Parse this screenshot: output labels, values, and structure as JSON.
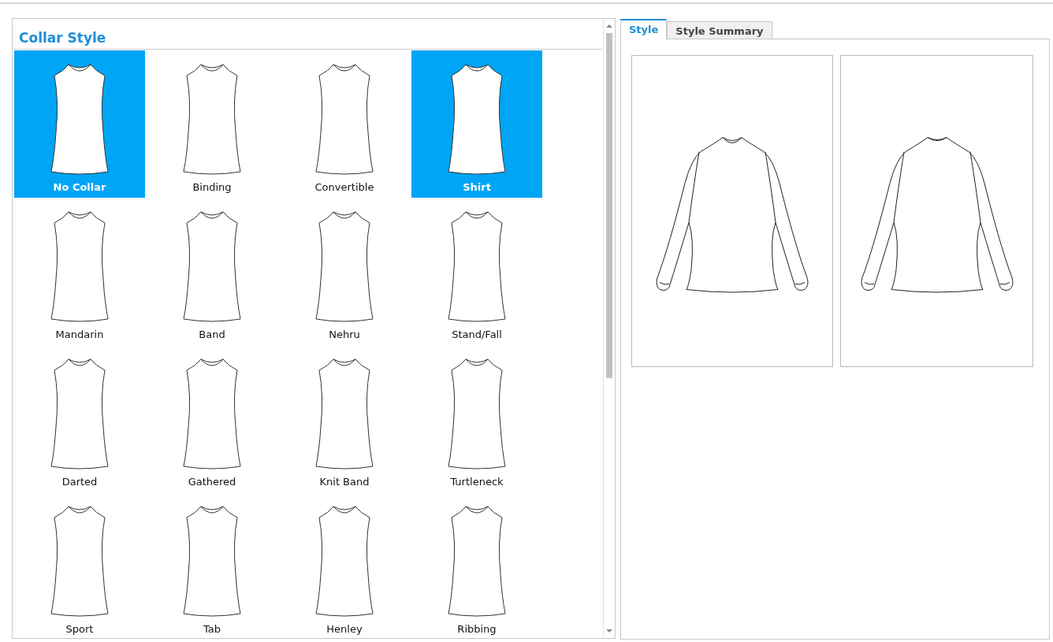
{
  "collar_panel": {
    "title": "Collar Style",
    "collars": [
      {
        "label": "No Collar",
        "selected": true
      },
      {
        "label": "Binding",
        "selected": false
      },
      {
        "label": "Convertible",
        "selected": false
      },
      {
        "label": "Shirt",
        "selected": true
      },
      {
        "label": "Mandarin",
        "selected": false
      },
      {
        "label": "Band",
        "selected": false
      },
      {
        "label": "Nehru",
        "selected": false
      },
      {
        "label": "Stand/Fall",
        "selected": false
      },
      {
        "label": "Darted",
        "selected": false
      },
      {
        "label": "Gathered",
        "selected": false
      },
      {
        "label": "Knit Band",
        "selected": false
      },
      {
        "label": "Turtleneck",
        "selected": false
      },
      {
        "label": "Sport",
        "selected": false
      },
      {
        "label": "Tab",
        "selected": false
      },
      {
        "label": "Henley",
        "selected": false
      },
      {
        "label": "Ribbing",
        "selected": false
      }
    ]
  },
  "preview_panel": {
    "tabs": [
      {
        "label": "Style",
        "selected": true
      },
      {
        "label": "Style Summary",
        "selected": false
      }
    ]
  }
}
